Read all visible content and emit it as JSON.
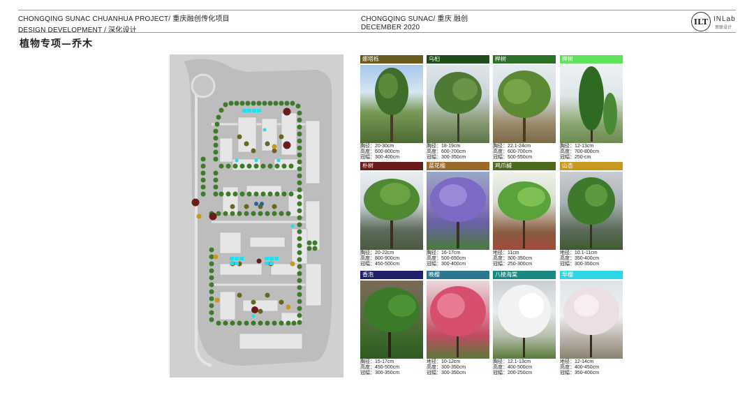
{
  "header": {
    "left_line1": "CHONGQING SUNAC CHUANHUA PROJECT/ 重庆融创传化项目",
    "left_line2": "DESIGN DEVELOPMENT / 深化设计",
    "center_line1": "CHONGQING SUNAC/ 重庆 融创",
    "center_line2": "DECEMBER 2020",
    "logo_mark": "ILT",
    "logo_name": "INLab",
    "logo_sub": "意联设计"
  },
  "page_title": "植物专项—乔木",
  "trees": [
    {
      "name": "娜塔栎",
      "color": "#6b5a1f",
      "specs": [
        "胸径：20-30cm",
        "高度：600-800cm",
        "冠幅：300-400cm"
      ]
    },
    {
      "name": "乌桕",
      "color": "#1f4d1a",
      "specs": [
        "胸径：18-19cm",
        "高度：600-700cm",
        "冠幅：300-350cm"
      ]
    },
    {
      "name": "榉树",
      "color": "#2e6f2a",
      "specs": [
        "胸径：22.1-24cm",
        "高度：600-700cm",
        "冠幅：500-550cm"
      ]
    },
    {
      "name": "榉树",
      "color": "#5ee35a",
      "specs": [
        "胸径：12-13cm",
        "高度：700-800cm",
        "冠幅：250-cm"
      ]
    },
    {
      "name": "朴树",
      "color": "#6a1c1c",
      "specs": [
        "胸径：20-22cm",
        "高度：800-900cm",
        "冠幅：450-500cm"
      ]
    },
    {
      "name": "蓝花楹",
      "color": "#9b6a2a",
      "specs": [
        "胸径：16-17cm",
        "高度：500-650cm",
        "冠幅：300-400cm"
      ]
    },
    {
      "name": "鸡爪槭",
      "color": "#4e6a1e",
      "specs": [
        "地径：11cm",
        "高度：300-350cm",
        "冠幅：250-300cm"
      ]
    },
    {
      "name": "山杏",
      "color": "#c9981f",
      "specs": [
        "地径：10.1-11cm",
        "高度：350-400cm",
        "冠幅：300-350cm"
      ]
    },
    {
      "name": "香泡",
      "color": "#1f1f6b",
      "specs": [
        "胸径：15-17cm",
        "高度：450-500cm",
        "冠幅：300-350cm"
      ]
    },
    {
      "name": "晚樱",
      "color": "#2c7790",
      "specs": [
        "地径：10-12cm",
        "高度：300-350cm",
        "冠幅：300-350cm"
      ]
    },
    {
      "name": "八棱海棠",
      "color": "#1a8a80",
      "specs": [
        "胸径：12.1-13cm",
        "高度：400-500cm",
        "冠幅：200-250cm"
      ]
    },
    {
      "name": "早樱",
      "color": "#2fd6e6",
      "specs": [
        "地径：12-14cm",
        "高度：400-450cm",
        "冠幅：350-400cm"
      ]
    }
  ]
}
